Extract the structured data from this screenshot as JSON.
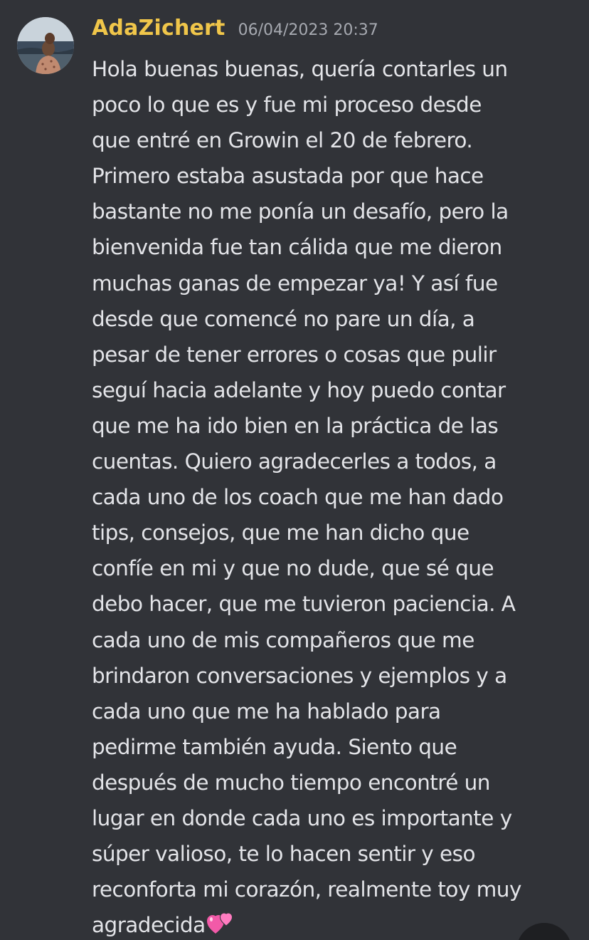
{
  "message": {
    "author": "AdaZichert",
    "timestamp": "06/04/2023 20:37",
    "lines": [
      "Hola buenas buenas, quería contarles un",
      "poco lo que es y fue mi proceso desde",
      "que entré en Growin el 20 de febrero.",
      "Primero estaba asustada por que hace",
      "bastante no me ponía un desafío, pero la",
      "bienvenida fue tan cálida que me dieron",
      "muchas ganas de empezar ya! Y así fue",
      "desde que comencé no pare un día, a",
      "pesar de tener errores o cosas que pulir",
      "seguí hacia adelante y hoy puedo contar",
      "que me ha ido bien en la práctica de las",
      "cuentas. Quiero agradecerles a todos, a",
      "cada uno de los coach que me han dado",
      "tips, consejos, que me han dicho que",
      "confíe en mi y que no dude, que sé que",
      "debo hacer, que me tuvieron paciencia. A",
      "cada uno de mis compañeros que me",
      "brindaron conversaciones y ejemplos y a",
      "cada uno que me ha hablado para",
      "pedirme también ayuda. Siento que",
      "después de mucho tiempo encontré un",
      "lugar en donde cada uno es importante y",
      "súper valioso, te lo hacen sentir y eso",
      "reconforta mi corazón, realmente toy muy",
      "agradecida"
    ],
    "trailing_emoji": "two-hearts-emoji"
  },
  "colors": {
    "background": "#313338",
    "username": "#f0c64a",
    "timestamp": "#a6a9b0",
    "text": "#e3e4e8"
  }
}
